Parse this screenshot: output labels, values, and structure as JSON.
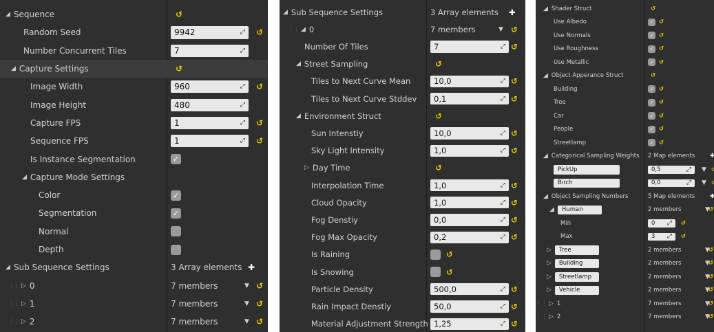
{
  "panel1": {
    "rows": [
      {
        "label": "Sequence",
        "kind": "header",
        "expanded": true,
        "value": "",
        "reset": true
      },
      {
        "label": "Random Seed",
        "value": "9942",
        "kind": "field",
        "reset": true
      },
      {
        "label": "Number Concurrent Tiles",
        "value": "7",
        "kind": "field",
        "reset": false
      },
      {
        "label": "Capture Settings",
        "kind": "header",
        "expanded": true,
        "value": "",
        "reset": true
      },
      {
        "label": "Image Width",
        "value": "960",
        "kind": "field",
        "reset": true
      },
      {
        "label": "Image Height",
        "value": "480",
        "kind": "field",
        "reset": false
      },
      {
        "label": "Capture FPS",
        "value": "1",
        "kind": "field",
        "reset": true
      },
      {
        "label": "Sequence FPS",
        "value": "1",
        "kind": "field",
        "reset": true
      },
      {
        "label": "Is Instance Segmentation",
        "kind": "check",
        "checked": true,
        "reset": false
      },
      {
        "label": "Capture Mode Settings",
        "kind": "header",
        "expanded": true,
        "value": "",
        "reset": false
      },
      {
        "label": "Color",
        "kind": "check",
        "checked": true,
        "reset": false
      },
      {
        "label": "Segmentation",
        "kind": "check",
        "checked": true,
        "reset": false
      },
      {
        "label": "Normal",
        "kind": "check",
        "checked": false,
        "reset": false
      },
      {
        "label": "Depth",
        "kind": "check",
        "checked": false,
        "reset": false
      },
      {
        "label": "Sub Sequence Settings",
        "kind": "array",
        "expanded": true,
        "value": "3 Array elements",
        "reset": false
      },
      {
        "label": "0",
        "kind": "members",
        "expanded": false,
        "value": "7 members",
        "reset": true
      },
      {
        "label": "1",
        "kind": "members",
        "expanded": false,
        "value": "7 members",
        "reset": true
      },
      {
        "label": "2",
        "kind": "members",
        "expanded": false,
        "value": "7 members",
        "reset": true
      }
    ]
  },
  "panel2": {
    "rows": [
      {
        "label": "Sub Sequence Settings",
        "kind": "array",
        "expanded": true,
        "value": "3 Array elements",
        "reset": false
      },
      {
        "label": "0",
        "kind": "members",
        "expanded": true,
        "value": "7 members",
        "reset": true
      },
      {
        "label": "Number Of Tiles",
        "value": "7",
        "kind": "field",
        "reset": true
      },
      {
        "label": "Street Sampling",
        "kind": "header",
        "expanded": true,
        "value": "",
        "reset": true
      },
      {
        "label": "Tiles to Next Curve Mean",
        "value": "10,0",
        "kind": "field",
        "reset": true
      },
      {
        "label": "Tiles to Next Curve Stddev",
        "value": "0,1",
        "kind": "field",
        "reset": true
      },
      {
        "label": "Environment Struct",
        "kind": "header",
        "expanded": true,
        "value": "",
        "reset": true
      },
      {
        "label": "Sun Intenstiy",
        "value": "10,0",
        "kind": "field",
        "reset": true
      },
      {
        "label": "Sky Light Intensity",
        "value": "1,0",
        "kind": "field",
        "reset": true
      },
      {
        "label": "Day Time",
        "kind": "header",
        "expanded": false,
        "value": "",
        "reset": true
      },
      {
        "label": "Interpolation Time",
        "value": "1,0",
        "kind": "field",
        "reset": true
      },
      {
        "label": "Cloud Opacity",
        "value": "1,0",
        "kind": "field",
        "reset": true
      },
      {
        "label": "Fog Denstiy",
        "value": "0,0",
        "kind": "field",
        "reset": true
      },
      {
        "label": "Fog Max Opacity",
        "value": "0,2",
        "kind": "field",
        "reset": true
      },
      {
        "label": "Is Raining",
        "kind": "check",
        "checked": false,
        "reset": true
      },
      {
        "label": "Is Snowing",
        "kind": "check",
        "checked": false,
        "reset": true
      },
      {
        "label": "Particle Density",
        "value": "500,0",
        "kind": "field",
        "reset": true
      },
      {
        "label": "Rain Impact Denstiy",
        "value": "50,0",
        "kind": "field",
        "reset": true
      },
      {
        "label": "Material Adjustment Strength",
        "value": "1,25",
        "kind": "field",
        "reset": true
      }
    ]
  },
  "panel3": {
    "rows": [
      {
        "label": "Shader Struct",
        "kind": "header",
        "expanded": true,
        "value": "",
        "reset": true
      },
      {
        "label": "Use Albedo",
        "kind": "check",
        "checked": true,
        "reset": true
      },
      {
        "label": "Use Normals",
        "kind": "check",
        "checked": true,
        "reset": true
      },
      {
        "label": "Use Roughness",
        "kind": "check",
        "checked": true,
        "reset": true
      },
      {
        "label": "Use Metallic",
        "kind": "check",
        "checked": true,
        "reset": true
      },
      {
        "label": "Object Apperance Struct",
        "kind": "header",
        "expanded": true,
        "value": "",
        "reset": true
      },
      {
        "label": "Building",
        "kind": "check",
        "checked": true,
        "reset": true
      },
      {
        "label": "Tree",
        "kind": "check",
        "checked": true,
        "reset": true
      },
      {
        "label": "Car",
        "kind": "check",
        "checked": true,
        "reset": true
      },
      {
        "label": "People",
        "kind": "check",
        "checked": true,
        "reset": true
      },
      {
        "label": "Streetlamp",
        "kind": "check",
        "checked": true,
        "reset": true
      },
      {
        "label": "Categorical Sampling Weights",
        "kind": "array",
        "expanded": true,
        "value": "2 Map elements",
        "reset": false
      },
      {
        "label": "PickUp",
        "kind": "mapkey",
        "value": "0,5",
        "reset": true
      },
      {
        "label": "Birch",
        "kind": "mapkey",
        "value": "0,0",
        "reset": true
      },
      {
        "label": "Object Sampling Numbers",
        "kind": "array",
        "expanded": true,
        "value": "5 Map elements",
        "reset": false
      },
      {
        "label": "Human",
        "kind": "mapkeymembers",
        "expanded": true,
        "value": "2 members",
        "reset": true
      },
      {
        "label": "Min",
        "value": "0",
        "kind": "smallfield",
        "reset": true
      },
      {
        "label": "Max",
        "value": "3",
        "kind": "smallfield",
        "reset": true
      },
      {
        "label": "Tree",
        "kind": "mapkeymembers",
        "expanded": false,
        "value": "2 members",
        "reset": true
      },
      {
        "label": "Building",
        "kind": "mapkeymembers",
        "expanded": false,
        "value": "2 members",
        "reset": true
      },
      {
        "label": "Streetlamp",
        "kind": "mapkeymembers",
        "expanded": false,
        "value": "2 members",
        "reset": true
      },
      {
        "label": "Vehicle",
        "kind": "mapkeymembers",
        "expanded": false,
        "value": "2 members",
        "reset": true
      },
      {
        "label": "1",
        "kind": "members",
        "expanded": false,
        "value": "7 members",
        "reset": true
      },
      {
        "label": "2",
        "kind": "members",
        "expanded": false,
        "value": "7 members",
        "reset": true
      }
    ]
  },
  "icons": {
    "expanded": "◢",
    "collapsed": "▷",
    "reset": "↺",
    "edit": "⤢",
    "check": "✓",
    "plus": "✚",
    "dropdown": "▼"
  },
  "colors": {
    "panel_bg": "#2f2f2f",
    "field_bg": "#e8e8e8",
    "reset_yellow": "#f0d000",
    "checkbox_bg": "#9a9a9a"
  }
}
